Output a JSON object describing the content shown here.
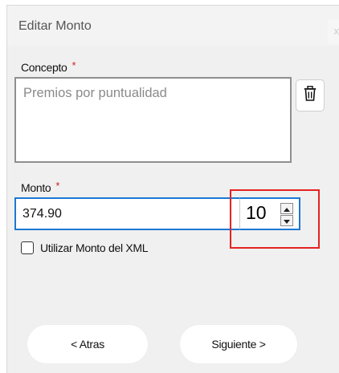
{
  "dialog": {
    "title": "Editar Monto",
    "close_label": "x"
  },
  "concept": {
    "label": "Concepto",
    "required_mark": "*",
    "value": "Premios por puntualidad"
  },
  "icons": {
    "delete": "trash-icon",
    "spin_up": "chevron-up-icon",
    "spin_down": "chevron-down-icon"
  },
  "amount": {
    "label": "Monto",
    "required_mark": "*",
    "value": "374.90",
    "decimals_value": "10"
  },
  "use_xml_amount": {
    "label": "Utilizar Monto del XML",
    "checked": false
  },
  "buttons": {
    "back_label": "< Atras",
    "next_label": "Siguiente >"
  },
  "colors": {
    "focus_border": "#1b78d4",
    "required": "#d12020",
    "highlight": "#e52222"
  }
}
